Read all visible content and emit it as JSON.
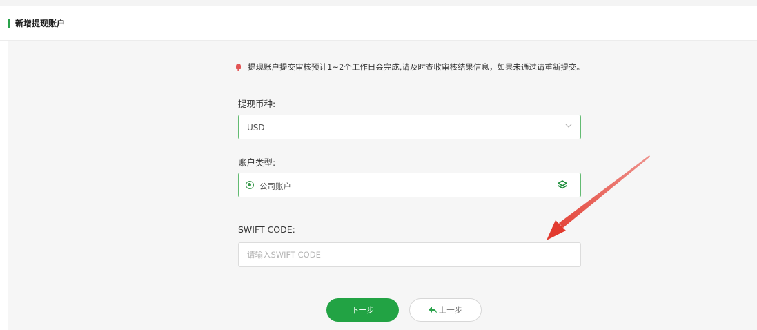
{
  "header": {
    "title": "新增提现账户"
  },
  "notice": {
    "text": "提现账户提交审核预计1~2个工作日会完成,请及时查收审核结果信息，如果未通过请重新提交。"
  },
  "form": {
    "currency": {
      "label": "提现币种:",
      "value": "USD"
    },
    "account_type": {
      "label": "账户类型:",
      "option": "公司账户"
    },
    "swift": {
      "label": "SWIFT CODE:",
      "placeholder": "请输入SWIFT CODE",
      "value": ""
    }
  },
  "buttons": {
    "next": "下一步",
    "prev": "上一步"
  },
  "colors": {
    "primary": "#22a344",
    "accent_border": "#63bb72",
    "alert": "#e25555",
    "annotation_arrow": "#e23a2e"
  },
  "icons": {
    "notice": "bell-icon",
    "select": "chevron-down-icon",
    "account_type": "layers-icon",
    "back": "back-arrow-icon"
  }
}
